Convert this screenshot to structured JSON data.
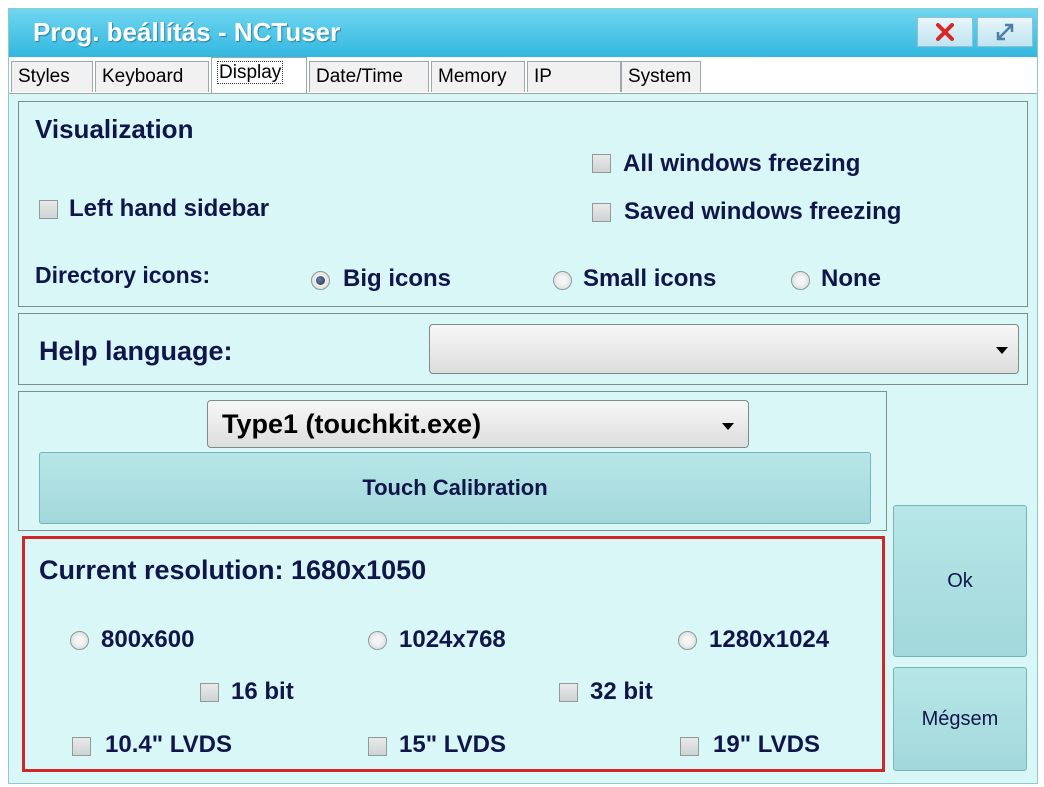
{
  "window": {
    "title": "Prog. beállítás - NCTuser",
    "close_icon": "close-icon",
    "maximize_icon": "maximize-icon"
  },
  "tabs": [
    "Styles",
    "Keyboard",
    "Display",
    "Date/Time",
    "Memory",
    "IP",
    "System"
  ],
  "active_tab": "Display",
  "visualization": {
    "heading": "Visualization",
    "all_windows_freezing": "All windows freezing",
    "left_hand_sidebar": "Left hand sidebar",
    "saved_windows_freezing": "Saved windows freezing",
    "directory_icons_label": "Directory icons:",
    "big_icons": "Big icons",
    "small_icons": "Small icons",
    "none": "None",
    "selected_icon_size": "Big icons"
  },
  "help": {
    "label": "Help language:",
    "value": ""
  },
  "touch": {
    "type_value": "Type1 (touchkit.exe)",
    "calibration_button": "Touch Calibration"
  },
  "resolution": {
    "heading": "Current resolution: 1680x1050",
    "res_800": "800x600",
    "res_1024": "1024x768",
    "res_1280": "1280x1024",
    "bit16": "16 bit",
    "bit32": "32 bit",
    "lvds_104": "10.4\" LVDS",
    "lvds_15": "15\" LVDS",
    "lvds_19": "19\" LVDS"
  },
  "buttons": {
    "ok": "Ok",
    "cancel": "Mégsem"
  },
  "colors": {
    "highlight_border": "#d0262a",
    "panel_background": "#d8f7f6",
    "title_bar": "#33b7e0"
  }
}
